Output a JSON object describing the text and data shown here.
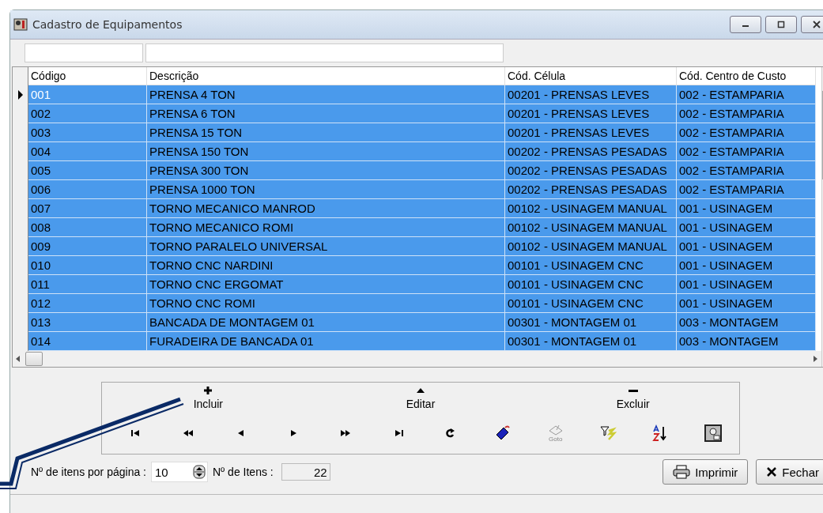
{
  "window": {
    "title": "Cadastro de Equipamentos"
  },
  "table": {
    "columns": [
      "Código",
      "Descrição",
      "Cód. Célula",
      "Cód. Centro de Custo"
    ],
    "rows": [
      {
        "cells": [
          "001",
          "PRENSA 4 TON",
          "00201 - PRENSAS LEVES",
          "002 - ESTAMPARIA"
        ],
        "selected": true,
        "current": true
      },
      {
        "cells": [
          "002",
          "PRENSA 6 TON",
          "00201 - PRENSAS LEVES",
          "002 - ESTAMPARIA"
        ],
        "selected": true,
        "current": false
      },
      {
        "cells": [
          "003",
          "PRENSA 15 TON",
          "00201 - PRENSAS LEVES",
          "002 - ESTAMPARIA"
        ],
        "selected": true,
        "current": false
      },
      {
        "cells": [
          "004",
          "PRENSA 150 TON",
          "00202 - PRENSAS PESADAS",
          "002 - ESTAMPARIA"
        ],
        "selected": true,
        "current": false
      },
      {
        "cells": [
          "005",
          "PRENSA 300 TON",
          "00202 - PRENSAS PESADAS",
          "002 - ESTAMPARIA"
        ],
        "selected": true,
        "current": false
      },
      {
        "cells": [
          "006",
          "PRENSA 1000 TON",
          "00202 - PRENSAS PESADAS",
          "002 - ESTAMPARIA"
        ],
        "selected": true,
        "current": false
      },
      {
        "cells": [
          "007",
          "TORNO MECANICO MANROD",
          "00102 - USINAGEM MANUAL",
          "001 - USINAGEM"
        ],
        "selected": true,
        "current": false
      },
      {
        "cells": [
          "008",
          "TORNO MECANICO ROMI",
          "00102 - USINAGEM MANUAL",
          "001 - USINAGEM"
        ],
        "selected": true,
        "current": false
      },
      {
        "cells": [
          "009",
          "TORNO PARALELO UNIVERSAL",
          "00102 - USINAGEM MANUAL",
          "001 - USINAGEM"
        ],
        "selected": true,
        "current": false
      },
      {
        "cells": [
          "010",
          "TORNO CNC NARDINI",
          "00101 - USINAGEM CNC",
          "001 - USINAGEM"
        ],
        "selected": true,
        "current": false
      },
      {
        "cells": [
          "011",
          "TORNO CNC ERGOMAT",
          "00101 - USINAGEM CNC",
          "001 - USINAGEM"
        ],
        "selected": true,
        "current": false
      },
      {
        "cells": [
          "012",
          "TORNO CNC ROMI",
          "00101 - USINAGEM CNC",
          "001 - USINAGEM"
        ],
        "selected": true,
        "current": false
      },
      {
        "cells": [
          "013",
          "BANCADA DE MONTAGEM 01",
          "00301 - MONTAGEM 01",
          "003 - MONTAGEM"
        ],
        "selected": true,
        "current": false
      },
      {
        "cells": [
          "014",
          "FURADEIRA DE BANCADA 01",
          "00301 - MONTAGEM 01",
          "003 - MONTAGEM"
        ],
        "selected": true,
        "current": false
      }
    ]
  },
  "actions": [
    {
      "label": "Incluir",
      "kind": "plus"
    },
    {
      "label": "Editar",
      "kind": "up"
    },
    {
      "label": "Excluir",
      "kind": "minus"
    }
  ],
  "navigator": [
    {
      "kind": "first"
    },
    {
      "kind": "prior"
    },
    {
      "kind": "prev"
    },
    {
      "kind": "next"
    },
    {
      "kind": "fastnext"
    },
    {
      "kind": "last"
    },
    {
      "kind": "refresh"
    },
    {
      "kind": "tag"
    },
    {
      "kind": "goto",
      "label": "Goto",
      "disabled": true
    },
    {
      "kind": "filter"
    },
    {
      "kind": "sort"
    },
    {
      "kind": "report"
    }
  ],
  "paging": {
    "label": "Nº de itens por página :",
    "value": "10",
    "count_label": "Nº de Itens :",
    "count": "22"
  },
  "buttons": [
    {
      "label": "Imprimir",
      "kind": "print"
    },
    {
      "label": "Fechar",
      "kind": "close"
    }
  ]
}
